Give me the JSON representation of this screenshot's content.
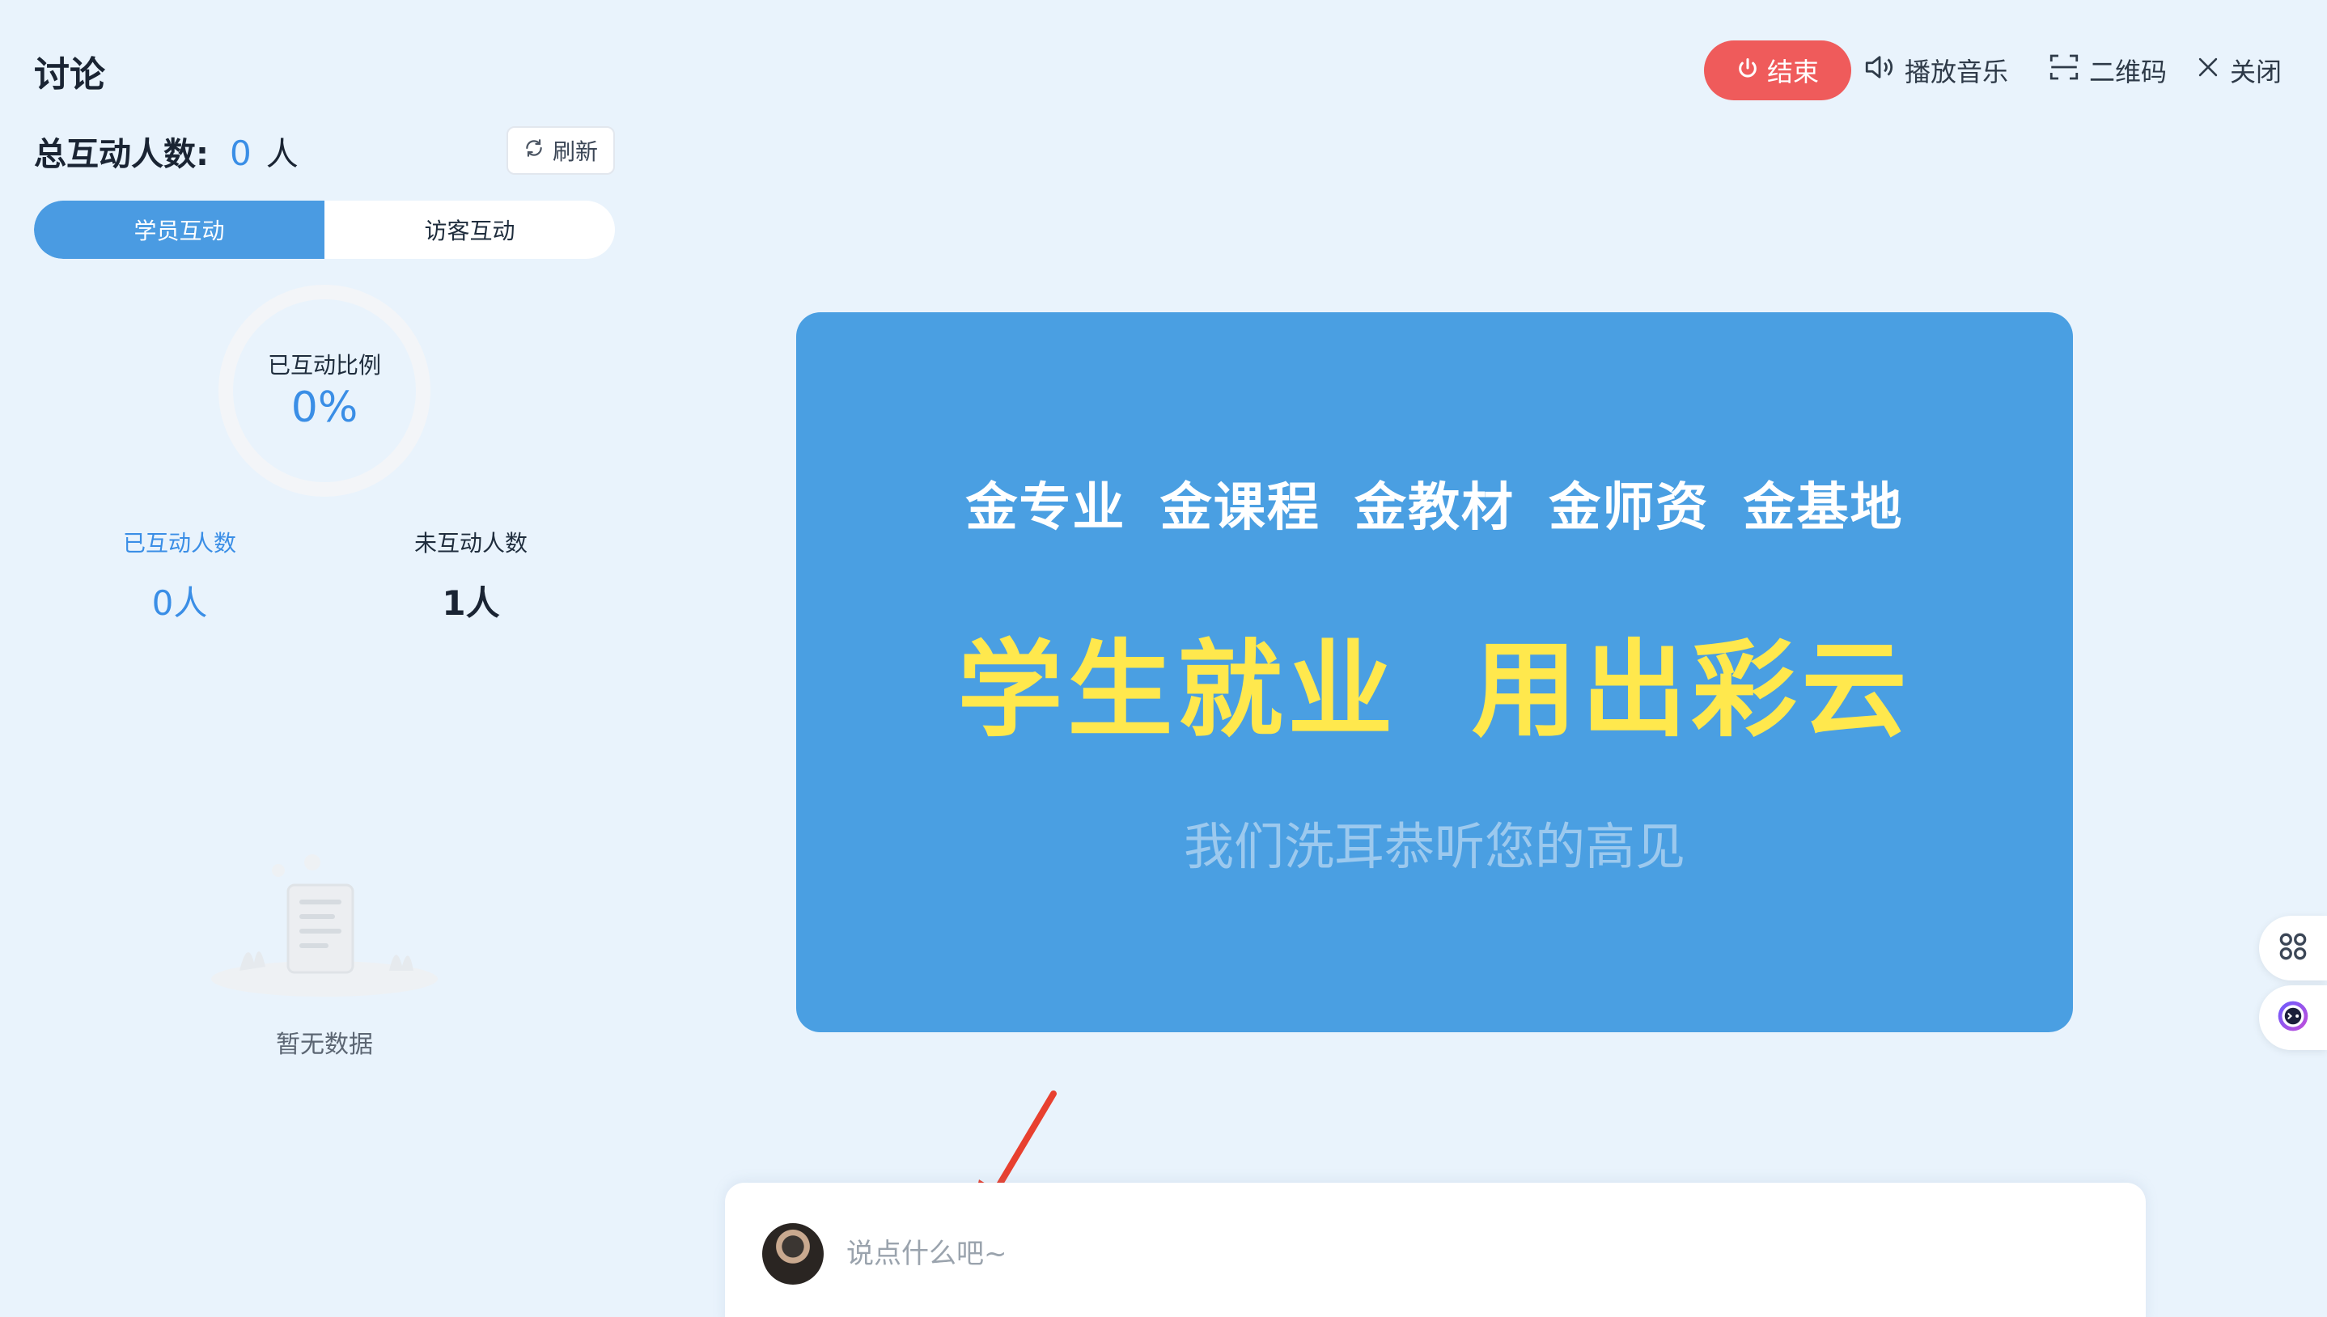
{
  "panel": {
    "title": "讨论",
    "total_label": "总互动人数:",
    "total_count": "0",
    "total_unit": "人",
    "refresh_label": "刷新",
    "tabs": [
      {
        "label": "学员互动",
        "active": true
      },
      {
        "label": "访客互动",
        "active": false
      }
    ],
    "ratio_label": "已互动比例",
    "ratio_value": "0%",
    "interacted_label": "已互动人数",
    "interacted_value": "0人",
    "not_interacted_label": "未互动人数",
    "not_interacted_value": "1人",
    "empty_text": "暂无数据"
  },
  "toolbar": {
    "end_label": "结束",
    "music_label": "播放音乐",
    "qr_label": "二维码",
    "close_label": "关闭"
  },
  "banner": {
    "line1": "金专业 金课程 金教材 金师资 金基地",
    "line2": "学生就业 用出彩云",
    "line3": "我们洗耳恭听您的高见",
    "bg_color": "#4a9fe2",
    "highlight_color": "#ffe84d"
  },
  "comment": {
    "placeholder": "说点什么吧~"
  },
  "colors": {
    "accent": "#4a9be2",
    "end_button": "#ef5b5b",
    "background": "#e9f3fc"
  },
  "icons": [
    "refresh-icon",
    "power-icon",
    "speaker-icon",
    "qr-scan-icon",
    "close-icon",
    "apps-icon",
    "assistant-bot-icon",
    "empty-doc-icon",
    "arrow-annotation"
  ]
}
